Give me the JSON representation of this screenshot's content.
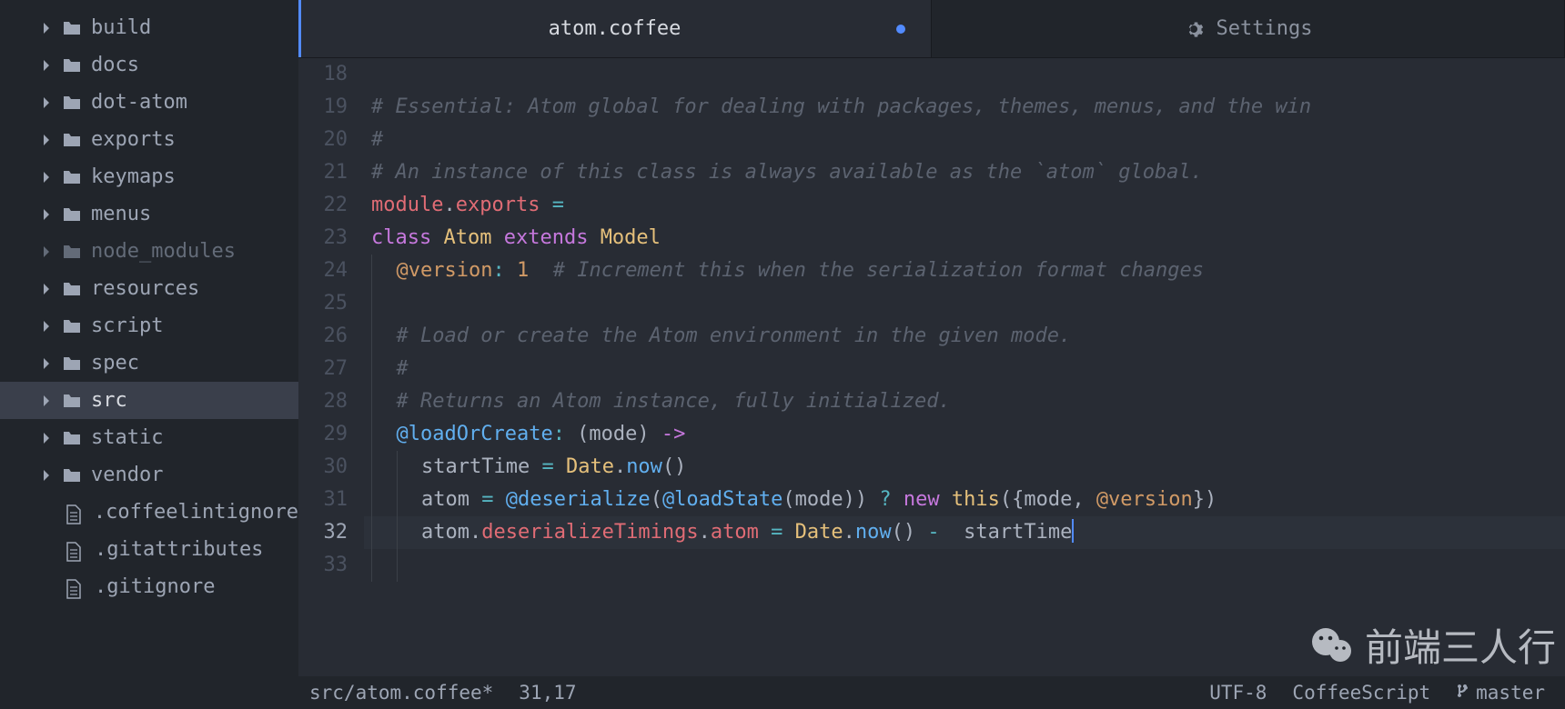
{
  "sidebar": {
    "items": [
      {
        "type": "folder",
        "label": "build",
        "muted": false
      },
      {
        "type": "folder",
        "label": "docs",
        "muted": false
      },
      {
        "type": "folder",
        "label": "dot-atom",
        "muted": false
      },
      {
        "type": "folder",
        "label": "exports",
        "muted": false
      },
      {
        "type": "folder",
        "label": "keymaps",
        "muted": false
      },
      {
        "type": "folder",
        "label": "menus",
        "muted": false
      },
      {
        "type": "folder",
        "label": "node_modules",
        "muted": true
      },
      {
        "type": "folder",
        "label": "resources",
        "muted": false
      },
      {
        "type": "folder",
        "label": "script",
        "muted": false
      },
      {
        "type": "folder",
        "label": "spec",
        "muted": false
      },
      {
        "type": "folder",
        "label": "src",
        "muted": false,
        "active": true
      },
      {
        "type": "folder",
        "label": "static",
        "muted": false
      },
      {
        "type": "folder",
        "label": "vendor",
        "muted": false
      },
      {
        "type": "file",
        "label": ".coffeelintignore",
        "muted": false
      },
      {
        "type": "file",
        "label": ".gitattributes",
        "muted": false
      },
      {
        "type": "file",
        "label": ".gitignore",
        "muted": false
      }
    ]
  },
  "tabs": {
    "items": [
      {
        "label": "atom.coffee",
        "modified": true,
        "active": true
      },
      {
        "label": "Settings",
        "icon": "gear",
        "active": false
      }
    ]
  },
  "statusbar": {
    "path": "src/atom.coffee*",
    "position": "31,17",
    "encoding": "UTF-8",
    "grammar": "CoffeeScript",
    "branch": "master"
  },
  "editor": {
    "first_line_number": 18,
    "cursor_line": 32,
    "lines": [
      {
        "n": 18,
        "tokens": []
      },
      {
        "n": 19,
        "tokens": [
          {
            "c": "c-cm",
            "t": "# Essential: Atom global for dealing with packages, themes, menus, and the win"
          }
        ]
      },
      {
        "n": 20,
        "tokens": [
          {
            "c": "c-cm",
            "t": "#"
          }
        ]
      },
      {
        "n": 21,
        "tokens": [
          {
            "c": "c-cm",
            "t": "# An instance of this class is always available as the `atom` global."
          }
        ]
      },
      {
        "n": 22,
        "tokens": [
          {
            "c": "c-pr",
            "t": "module"
          },
          {
            "c": "c-txt",
            "t": "."
          },
          {
            "c": "c-pr",
            "t": "exports"
          },
          {
            "c": "c-txt",
            "t": " "
          },
          {
            "c": "c-op",
            "t": "="
          }
        ]
      },
      {
        "n": 23,
        "tokens": [
          {
            "c": "c-kw",
            "t": "class"
          },
          {
            "c": "c-txt",
            "t": " "
          },
          {
            "c": "c-cls",
            "t": "Atom"
          },
          {
            "c": "c-txt",
            "t": " "
          },
          {
            "c": "c-kw",
            "t": "extends"
          },
          {
            "c": "c-txt",
            "t": " "
          },
          {
            "c": "c-cls",
            "t": "Model"
          }
        ]
      },
      {
        "n": 24,
        "indent": 1,
        "tokens": [
          {
            "c": "c-at",
            "t": "@version"
          },
          {
            "c": "c-op",
            "t": ":"
          },
          {
            "c": "c-txt",
            "t": " "
          },
          {
            "c": "c-num",
            "t": "1"
          },
          {
            "c": "c-txt",
            "t": "  "
          },
          {
            "c": "c-cm",
            "t": "# Increment this when the serialization format changes"
          }
        ]
      },
      {
        "n": 25,
        "indent": 1,
        "tokens": []
      },
      {
        "n": 26,
        "indent": 1,
        "tokens": [
          {
            "c": "c-cm",
            "t": "# Load or create the Atom environment in the given mode."
          }
        ]
      },
      {
        "n": 27,
        "indent": 1,
        "tokens": [
          {
            "c": "c-cm",
            "t": "#"
          }
        ]
      },
      {
        "n": 28,
        "indent": 1,
        "tokens": [
          {
            "c": "c-cm",
            "t": "# Returns an Atom instance, fully initialized."
          }
        ]
      },
      {
        "n": 29,
        "indent": 1,
        "tokens": [
          {
            "c": "c-fn",
            "t": "@loadOrCreate"
          },
          {
            "c": "c-op",
            "t": ":"
          },
          {
            "c": "c-txt",
            "t": " (mode) "
          },
          {
            "c": "c-kw",
            "t": "->"
          }
        ]
      },
      {
        "n": 30,
        "indent": 2,
        "tokens": [
          {
            "c": "c-txt",
            "t": "startTime "
          },
          {
            "c": "c-op",
            "t": "="
          },
          {
            "c": "c-txt",
            "t": " "
          },
          {
            "c": "c-cls",
            "t": "Date"
          },
          {
            "c": "c-txt",
            "t": "."
          },
          {
            "c": "c-fn",
            "t": "now"
          },
          {
            "c": "c-txt",
            "t": "()"
          }
        ]
      },
      {
        "n": 31,
        "indent": 2,
        "tokens": [
          {
            "c": "c-txt",
            "t": "atom "
          },
          {
            "c": "c-op",
            "t": "="
          },
          {
            "c": "c-txt",
            "t": " "
          },
          {
            "c": "c-fn",
            "t": "@deserialize"
          },
          {
            "c": "c-txt",
            "t": "("
          },
          {
            "c": "c-fn",
            "t": "@loadState"
          },
          {
            "c": "c-txt",
            "t": "(mode)) "
          },
          {
            "c": "c-op",
            "t": "?"
          },
          {
            "c": "c-txt",
            "t": " "
          },
          {
            "c": "c-kw",
            "t": "new"
          },
          {
            "c": "c-txt",
            "t": " "
          },
          {
            "c": "c-this",
            "t": "this"
          },
          {
            "c": "c-txt",
            "t": "({mode, "
          },
          {
            "c": "c-at",
            "t": "@version"
          },
          {
            "c": "c-txt",
            "t": "})"
          }
        ]
      },
      {
        "n": 32,
        "indent": 2,
        "cur": true,
        "tokens": [
          {
            "c": "c-txt",
            "t": "atom."
          },
          {
            "c": "c-var",
            "t": "deserializeTimings"
          },
          {
            "c": "c-txt",
            "t": "."
          },
          {
            "c": "c-var",
            "t": "atom"
          },
          {
            "c": "c-txt",
            "t": " "
          },
          {
            "c": "c-op",
            "t": "="
          },
          {
            "c": "c-txt",
            "t": " "
          },
          {
            "c": "c-cls",
            "t": "Date"
          },
          {
            "c": "c-txt",
            "t": "."
          },
          {
            "c": "c-fn",
            "t": "now"
          },
          {
            "c": "c-txt",
            "t": "() "
          },
          {
            "c": "c-op",
            "t": "-"
          },
          {
            "c": "c-txt",
            "t": "  startTime"
          },
          {
            "c": "cursor",
            "t": ""
          }
        ]
      },
      {
        "n": 33,
        "indent": 2,
        "tokens": []
      }
    ]
  },
  "watermark": {
    "text": "前端三人行"
  }
}
